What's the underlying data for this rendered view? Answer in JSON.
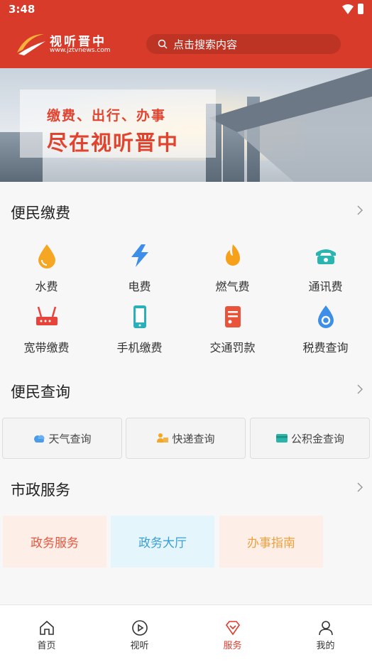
{
  "status_bar": {
    "time": "3:48"
  },
  "header": {
    "logo_name": "视听晋中",
    "logo_url": "www.jztvnews.com",
    "search_placeholder": "点击搜索内容"
  },
  "banner": {
    "line1": "缴费、出行、办事",
    "line2": "尽在视听晋中"
  },
  "payment": {
    "title": "便民缴费",
    "items": [
      {
        "label": "水费",
        "icon": "water-drop-icon",
        "color": "#f5a623"
      },
      {
        "label": "电费",
        "icon": "lightning-icon",
        "color": "#3d8ee8"
      },
      {
        "label": "燃气费",
        "icon": "flame-icon",
        "color": "#f7a11a"
      },
      {
        "label": "通讯费",
        "icon": "telephone-icon",
        "color": "#2bb5b0"
      },
      {
        "label": "宽带缴费",
        "icon": "router-icon",
        "color": "#e8433a"
      },
      {
        "label": "手机缴费",
        "icon": "mobile-phone-icon",
        "color": "#2ab0b8"
      },
      {
        "label": "交通罚款",
        "icon": "ticket-icon",
        "color": "#e8533a"
      },
      {
        "label": "税费查询",
        "icon": "tax-drop-icon",
        "color": "#3d8ee8"
      }
    ]
  },
  "query": {
    "title": "便民查询",
    "items": [
      {
        "label": "天气查询",
        "icon": "cloud-icon"
      },
      {
        "label": "快递查询",
        "icon": "courier-icon"
      },
      {
        "label": "公积金查询",
        "icon": "card-icon"
      }
    ]
  },
  "civic": {
    "title": "市政服务",
    "items": [
      {
        "label": "政务服务",
        "bg": "#fdeee8",
        "color": "#e8553e"
      },
      {
        "label": "政务大厅",
        "bg": "#e4f5fc",
        "color": "#3a9ed6"
      },
      {
        "label": "办事指南",
        "bg": "#fdeee8",
        "color": "#f0a03a"
      }
    ]
  },
  "nav": {
    "items": [
      {
        "label": "首页",
        "icon": "home-icon"
      },
      {
        "label": "视听",
        "icon": "play-icon"
      },
      {
        "label": "服务",
        "icon": "service-diamond-icon"
      },
      {
        "label": "我的",
        "icon": "profile-icon"
      }
    ],
    "active_label": "服务",
    "active_color": "#e0392b"
  }
}
